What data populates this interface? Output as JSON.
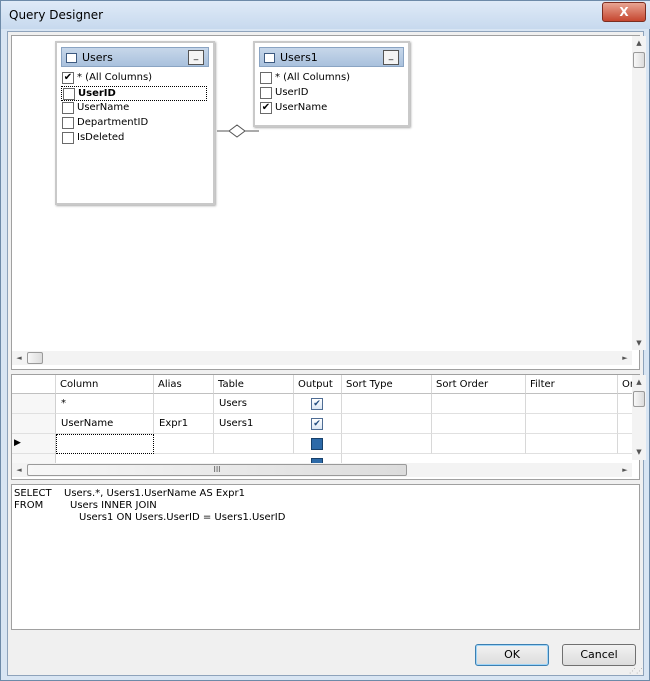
{
  "window": {
    "title": "Query Designer",
    "close_glyph": "X"
  },
  "diagram": {
    "tables": [
      {
        "name": "Users",
        "minimize_glyph": "_",
        "columns": [
          {
            "label": "* (All Columns)",
            "checked": true
          },
          {
            "label": "UserID",
            "checked": false
          },
          {
            "label": "UserName",
            "checked": false
          },
          {
            "label": "DepartmentID",
            "checked": false
          },
          {
            "label": "IsDeleted",
            "checked": false
          }
        ]
      },
      {
        "name": "Users1",
        "minimize_glyph": "_",
        "columns": [
          {
            "label": "* (All Columns)",
            "checked": false
          },
          {
            "label": "UserID",
            "checked": false
          },
          {
            "label": "UserName",
            "checked": true
          }
        ]
      }
    ]
  },
  "grid": {
    "headers": [
      "Column",
      "Alias",
      "Table",
      "Output",
      "Sort Type",
      "Sort Order",
      "Filter",
      "Or"
    ],
    "rows": [
      {
        "column": "*",
        "alias": "",
        "table": "Users",
        "output": true
      },
      {
        "column": "UserName",
        "alias": "Expr1",
        "table": "Users1",
        "output": true
      },
      {
        "column": "",
        "alias": "",
        "table": "",
        "output": false
      }
    ],
    "hscroll_grip": "III"
  },
  "sql": {
    "lines": [
      [
        "SELECT",
        "Users.*, Users1.UserName AS Expr1"
      ],
      [
        "FROM",
        "Users INNER JOIN"
      ],
      [
        "",
        "Users1 ON Users.UserID = Users1.UserID"
      ]
    ]
  },
  "buttons": {
    "ok": "OK",
    "cancel": "Cancel"
  },
  "icons": {
    "check": "✔",
    "arrow_up": "▲",
    "arrow_down": "▼",
    "arrow_left": "◄",
    "arrow_right": "►",
    "row_pointer": "▶"
  }
}
